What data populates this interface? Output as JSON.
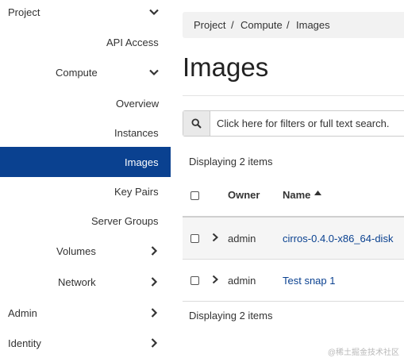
{
  "sidebar": {
    "project": "Project",
    "api_access": "API Access",
    "compute": "Compute",
    "overview": "Overview",
    "instances": "Instances",
    "images": "Images",
    "key_pairs": "Key Pairs",
    "server_groups": "Server Groups",
    "volumes": "Volumes",
    "network": "Network",
    "admin": "Admin",
    "identity": "Identity"
  },
  "breadcrumb": {
    "project": "Project",
    "compute": "Compute",
    "images": "Images",
    "separator": "/"
  },
  "page": {
    "title": "Images"
  },
  "filter": {
    "placeholder": "Click here for filters or full text search."
  },
  "table": {
    "count_top": "Displaying 2 items",
    "count_bottom": "Displaying 2 items",
    "headers": {
      "owner": "Owner",
      "name": "Name"
    },
    "rows": [
      {
        "owner": "admin",
        "name": "cirros-0.4.0-x86_64-disk"
      },
      {
        "owner": "admin",
        "name": "Test snap 1"
      }
    ]
  },
  "watermark": "@稀土掘金技术社区",
  "colors": {
    "active_bg": "#0a4190",
    "link": "#0a4190"
  }
}
